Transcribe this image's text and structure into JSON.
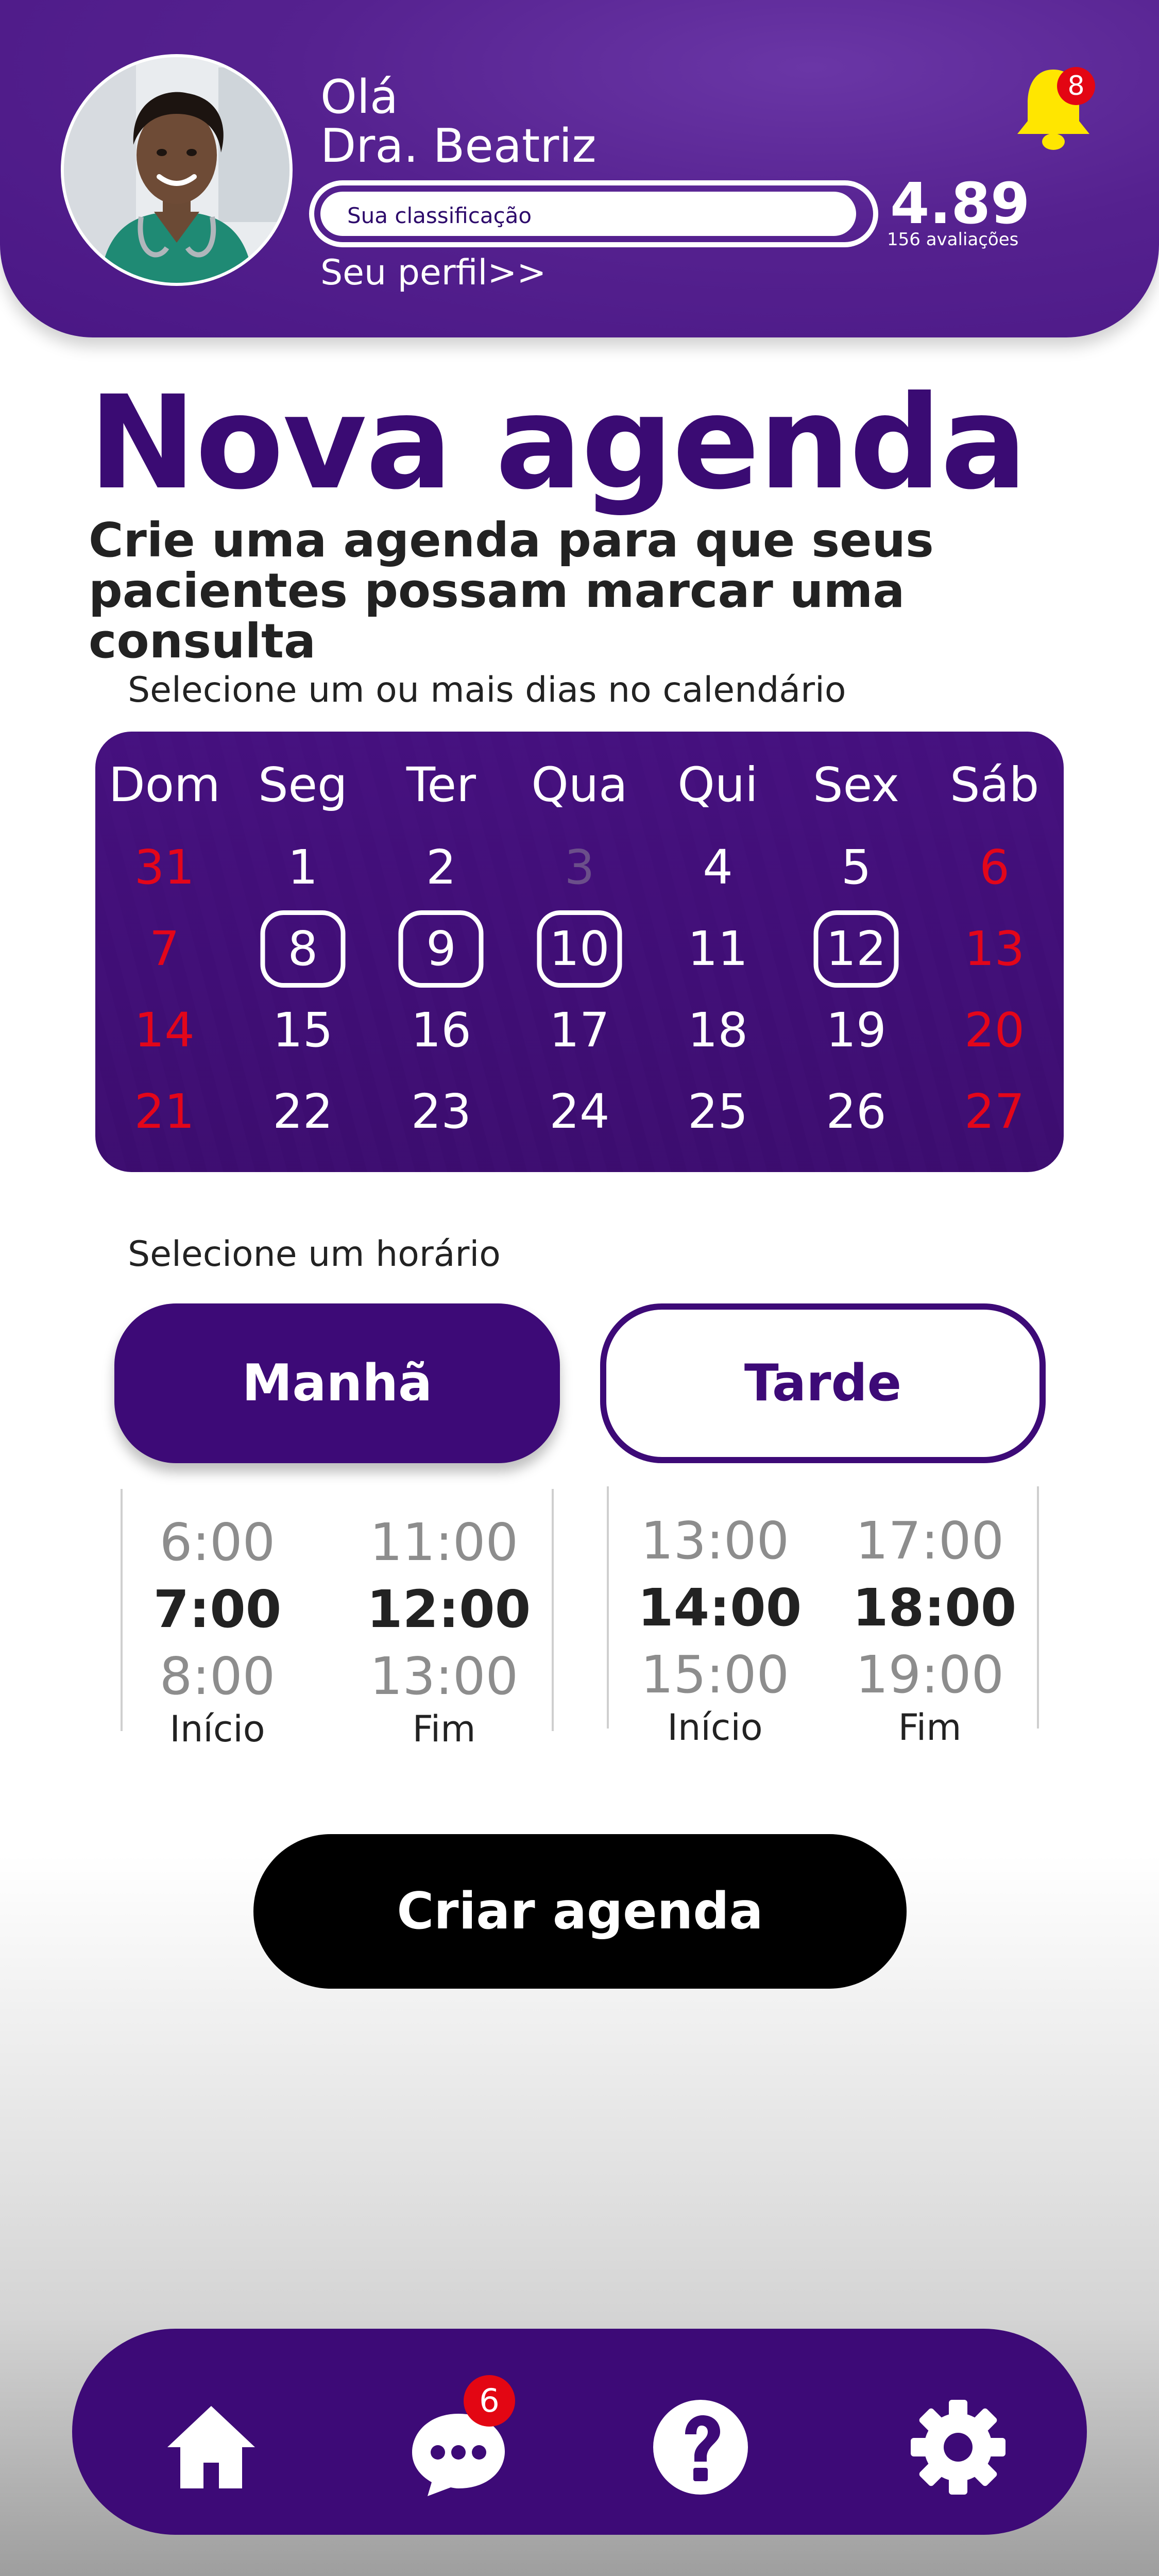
{
  "header": {
    "greeting": "Olá",
    "name": "Dra. Beatriz",
    "rating_label": "Sua classificação",
    "rating_score": "4.89",
    "rating_count": "156 avaliações",
    "profile_link": "Seu perfil>>",
    "notification_count": "8",
    "avatar": "doctor-photo"
  },
  "main": {
    "title": "Nova agenda",
    "subtitle": "Crie uma agenda para que seus pacientes possam marcar uma consulta"
  },
  "calendar": {
    "label": "Selecione um ou mais dias no calendário",
    "weekdays": [
      "Dom",
      "Seg",
      "Ter",
      "Qua",
      "Qui",
      "Sex",
      "Sáb"
    ],
    "weeks": [
      [
        "31",
        "1",
        "2",
        "3",
        "4",
        "5",
        "6"
      ],
      [
        "7",
        "8",
        "9",
        "10",
        "11",
        "12",
        "13"
      ],
      [
        "14",
        "15",
        "16",
        "17",
        "18",
        "19",
        "20"
      ],
      [
        "21",
        "22",
        "23",
        "24",
        "25",
        "26",
        "27"
      ]
    ],
    "selected_days": [
      "8",
      "9",
      "10",
      "12"
    ],
    "disabled_days": [
      "3"
    ]
  },
  "schedule": {
    "label": "Selecione um horário",
    "morning_label": "Manhã",
    "afternoon_label": "Tarde",
    "selected_period": "Manhã",
    "morning": {
      "start": [
        "6:00",
        "7:00",
        "8:00"
      ],
      "end": [
        "11:00",
        "12:00",
        "13:00"
      ],
      "start_caption": "Início",
      "end_caption": "Fim"
    },
    "afternoon": {
      "start": [
        "13:00",
        "14:00",
        "15:00"
      ],
      "end": [
        "17:00",
        "18:00",
        "19:00"
      ],
      "start_caption": "Início",
      "end_caption": "Fim"
    }
  },
  "actions": {
    "create_label": "Criar agenda"
  },
  "bottom_nav": {
    "items": [
      "home-icon",
      "chat-icon",
      "help-icon",
      "settings-icon"
    ],
    "chat_badge": "6"
  },
  "colors": {
    "primary": "#3d0a77",
    "header": "#55218f",
    "weekend": "#e3061a",
    "badge": "#e30613",
    "bell": "#ffe600"
  }
}
